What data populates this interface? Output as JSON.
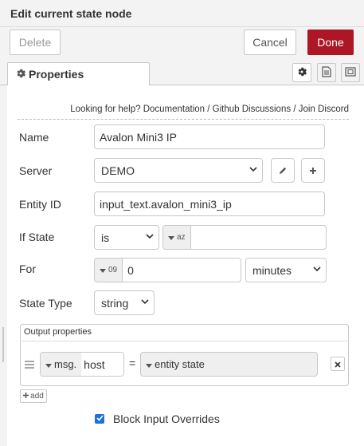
{
  "dialog": {
    "title": "Edit current state node",
    "delete_label": "Delete",
    "cancel_label": "Cancel",
    "done_label": "Done"
  },
  "tabs": {
    "properties_label": "Properties"
  },
  "help": {
    "prefix": "Looking for help?",
    "documentation": "Documentation",
    "sep1": "/",
    "github": "Github Discussions",
    "sep2": "/",
    "discord": "Join Discord"
  },
  "form": {
    "name_label": "Name",
    "name_value": "Avalon Mini3 IP",
    "server_label": "Server",
    "server_value": "DEMO",
    "entity_label": "Entity ID",
    "entity_value": "input_text.avalon_mini3_ip",
    "ifstate_label": "If State",
    "ifstate_operator": "is",
    "ifstate_type_icon": "az",
    "ifstate_value": "",
    "for_label": "For",
    "for_type_icon": "09",
    "for_value": "0",
    "for_unit": "minutes",
    "statetype_label": "State Type",
    "statetype_value": "string"
  },
  "output": {
    "title": "Output properties",
    "rows": [
      {
        "target_prefix": "msg.",
        "target_value": "host",
        "equals": "=",
        "source_value": "entity state"
      }
    ],
    "add_label": "add"
  },
  "block_overrides": {
    "label": "Block Input Overrides",
    "checked": true
  }
}
